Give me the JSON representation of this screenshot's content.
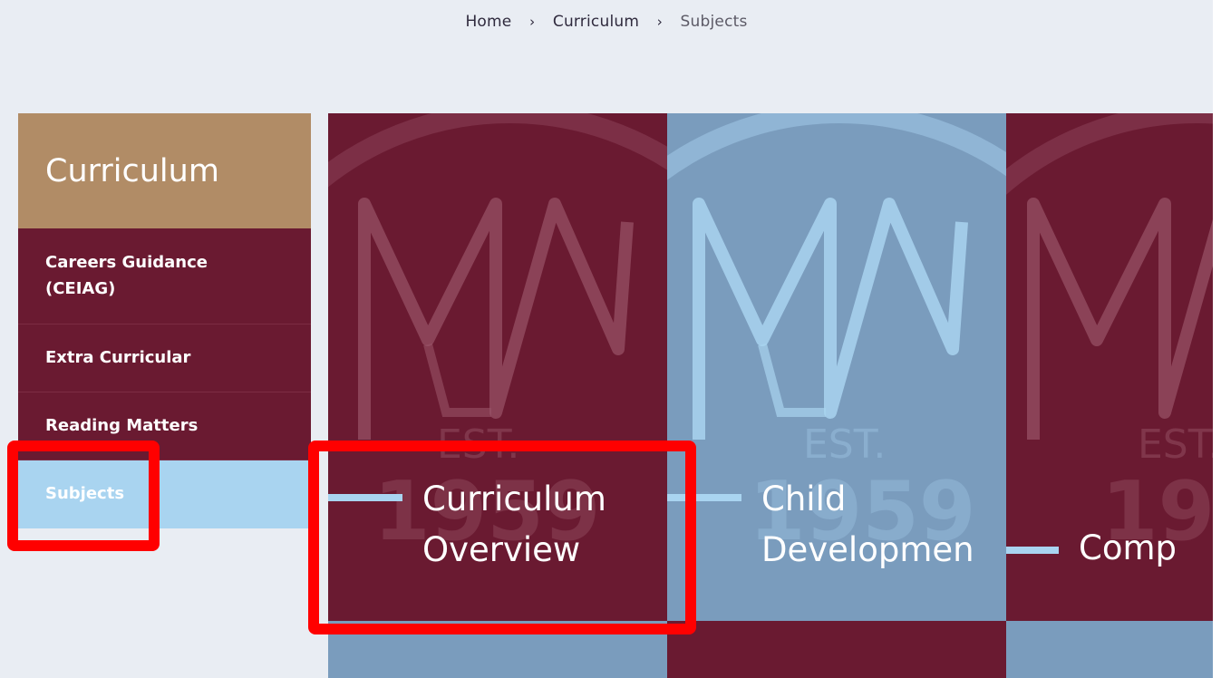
{
  "breadcrumb": {
    "home": "Home",
    "curriculum": "Curriculum",
    "current": "Subjects",
    "separator": "›"
  },
  "sidebar": {
    "heading": "Curriculum",
    "items": [
      {
        "label": "Careers Guidance (CEIAG)"
      },
      {
        "label": "Extra Curricular"
      },
      {
        "label": "Reading Matters"
      },
      {
        "label": "Subjects",
        "active": true
      }
    ]
  },
  "tiles": [
    {
      "label": "Curriculum Overview",
      "color": "maroon"
    },
    {
      "label": "Child Developmen",
      "color": "blue"
    },
    {
      "label": "Comp",
      "color": "maroon"
    }
  ],
  "colors": {
    "maroon": "#6a1a31",
    "blue": "#7a9cbd",
    "light_blue": "#a9d4f0",
    "tan": "#b18c66",
    "highlight": "#ff0000"
  },
  "logo": {
    "est_text": "EST.",
    "year_text": "1959"
  }
}
